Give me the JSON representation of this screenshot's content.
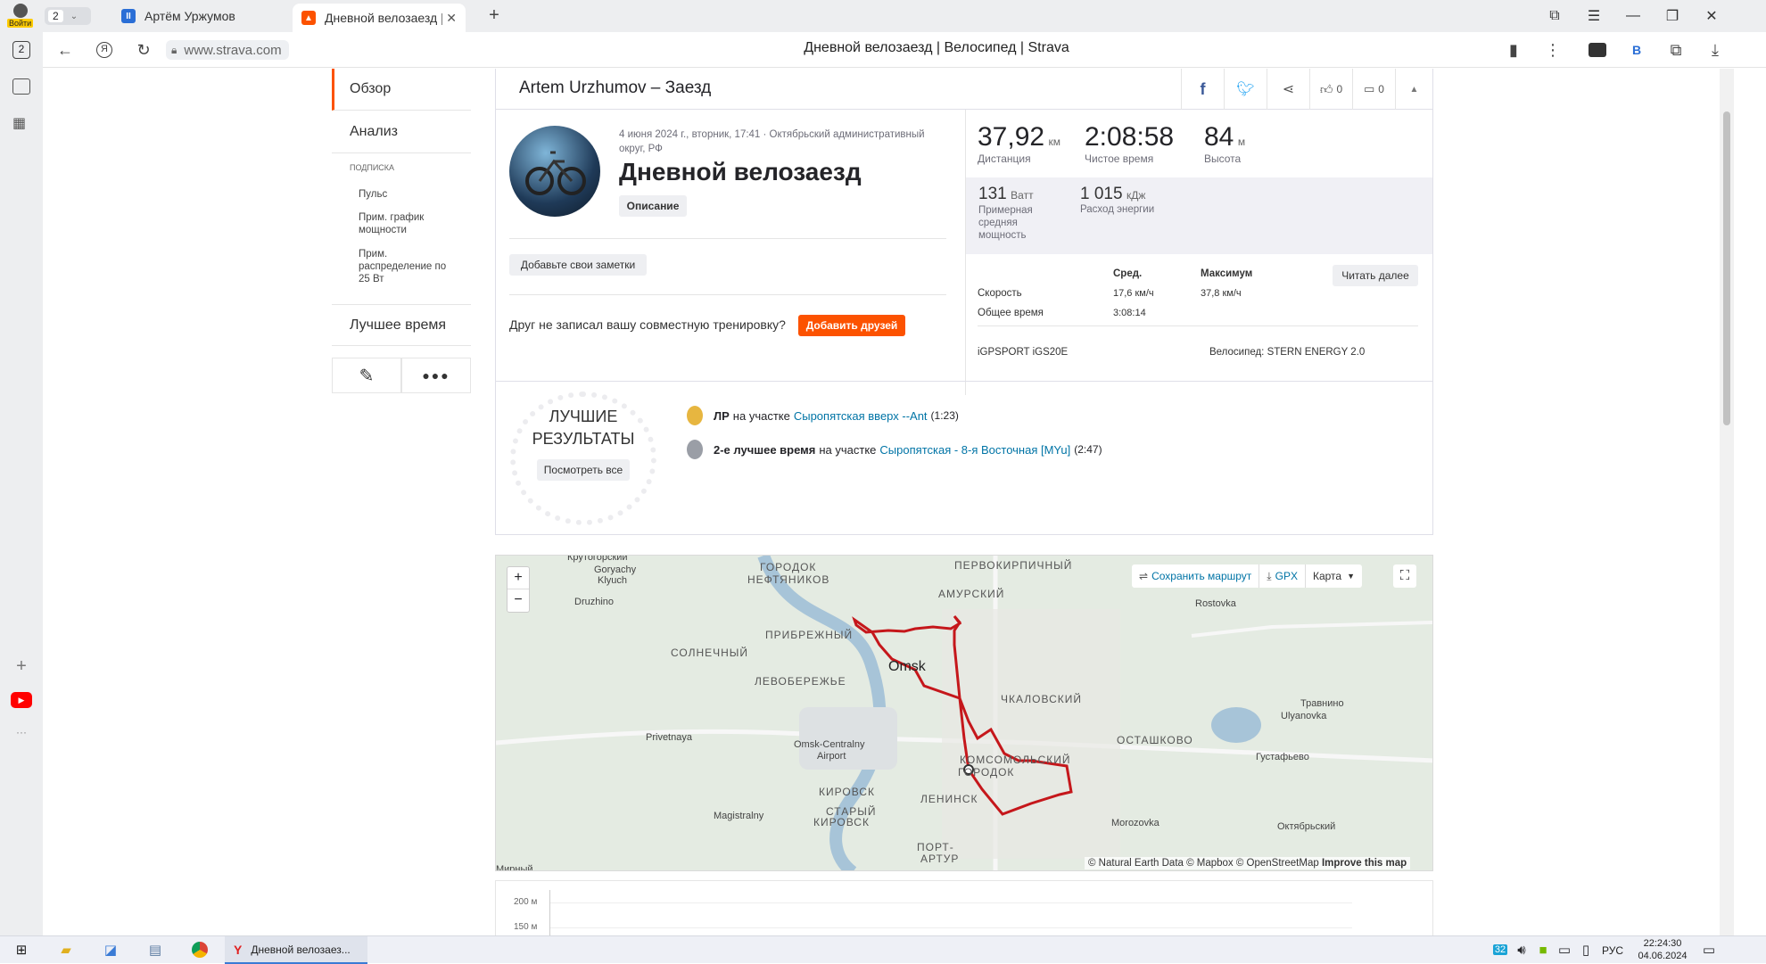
{
  "browser": {
    "profile_label": "Войти",
    "tab_counter": "2",
    "tabs": [
      {
        "label": "Артём Уржумов",
        "favicon_color": "#1a73e8"
      },
      {
        "label": "Дневной велозаезд | В",
        "favicon_color": "#fc5200"
      }
    ],
    "url": "www.strava.com",
    "page_title": "Дневной велозаезд | Велосипед | Strava",
    "rail_badge": "2",
    "toolbar_badge": "В"
  },
  "side_nav": {
    "overview": "Обзор",
    "analysis": "Анализ",
    "subscription": "ПОДПИСКА",
    "sub_items": [
      "Пульс",
      "Прим. график мощности",
      "Прим. распределение по 25 Вт"
    ],
    "best_times": "Лучшее время"
  },
  "header": {
    "title": "Artem Urzhumov – Заезд",
    "kudos_count": "0",
    "comments_count": "0"
  },
  "activity": {
    "datetime": "4 июня 2024 г., вторник, 17:41 · Октябрьский административный округ, РФ",
    "name": "Дневной велозаезд",
    "description_button": "Описание",
    "add_notes_button": "Добавьте свои заметки",
    "friend_prompt": "Друг не записал вашу совместную тренировку?",
    "add_friends_button": "Добавить друзей"
  },
  "stats": {
    "distance": {
      "value": "37,92",
      "unit": "км",
      "label": "Дистанция"
    },
    "moving_time": {
      "value": "2:08:58",
      "label": "Чистое время"
    },
    "elevation": {
      "value": "84",
      "unit": "м",
      "label": "Высота"
    },
    "power": {
      "value": "131",
      "unit": "Ватт",
      "label": "Примерная средняя мощность"
    },
    "energy": {
      "value": "1 015",
      "unit": "кДж",
      "label": "Расход энергии"
    },
    "table": {
      "col_avg": "Сред.",
      "col_max": "Максимум",
      "read_more": "Читать далее",
      "rows": [
        {
          "label": "Скорость",
          "avg": "17,6 км/ч",
          "max": "37,8 км/ч"
        },
        {
          "label": "Общее время",
          "avg": "3:08:14",
          "max": ""
        }
      ]
    },
    "device": "iGPSPORT iGS20E",
    "bike": "Велосипед: STERN ENERGY 2.0"
  },
  "best_results": {
    "heading_line1": "ЛУЧШИЕ",
    "heading_line2": "РЕЗУЛЬТАТЫ",
    "view_all": "Посмотреть все",
    "items": [
      {
        "bold": "ЛР",
        "middle": "на участке",
        "segment": "Сыропятская вверх --Ant",
        "time": "(1:23)",
        "medal_color": "#e7b640"
      },
      {
        "bold": "2-е лучшее время",
        "middle": "на участке",
        "segment": "Сыропятская - 8-я Восточная [MYu]",
        "time": "(2:47)",
        "medal_color": "#9a9ea6"
      }
    ]
  },
  "map": {
    "zoom_in": "+",
    "zoom_out": "−",
    "save_route": "Сохранить маршрут",
    "gpx": "GPX",
    "map_type": "Карта",
    "attribution": "© Natural Earth Data © Mapbox © OpenStreetMap",
    "improve": "Improve this map",
    "labels": {
      "gorodok": "ГОРОДОК",
      "neftyanikov": "НЕФТЯНИКОВ",
      "pervokirpichny": "ПЕРВОКИРПИЧНЫЙ",
      "amursky": "АМУРСКИЙ",
      "goryachy": "Goryachy",
      "klyuch": "Klyuch",
      "druzhino": "Druzhino",
      "rostovka": "Rostovka",
      "pribrezhny": "ПРИБРЕЖНЫЙ",
      "solnechny": "СОЛНЕЧНЫЙ",
      "omsk": "Omsk",
      "levoberezhye": "ЛЕВОБЕРЕЖЬЕ",
      "chkalovsky": "ЧКАЛОВСКИЙ",
      "travnino": "Травнино",
      "ulyanovka": "Ulyanovka",
      "privetnaya": "Privetnaya",
      "airport1": "Omsk-Centralny",
      "airport2": "Airport",
      "ostashkovo": "ОСТАШКОВО",
      "komsomolsky": "КОМСОМОЛЬСКИЙ",
      "gorodok2": "ГОРОДОК",
      "gustafyevo": "Густафьево",
      "kirovsk": "КИРОВСК",
      "starykirovsk1": "СТАРЫЙ",
      "starykirovsk2": "КИРОВСК",
      "leninsk": "ЛЕНИНСК",
      "magistralny": "Magistralny",
      "morozovka": "Morozovka",
      "oktyabrsky": "Октябрьский",
      "portartur1": "ПОРТ-",
      "portartur2": "АРТУР",
      "mirny": "Мирный",
      "krutogorsky": "Крутогорский"
    }
  },
  "elevation": {
    "tick_200": "200 м",
    "tick_150": "150 м"
  },
  "taskbar": {
    "active_app": "Дневной велозаез...",
    "lang": "РУС",
    "time": "22:24:30",
    "date": "04.06.2024"
  }
}
